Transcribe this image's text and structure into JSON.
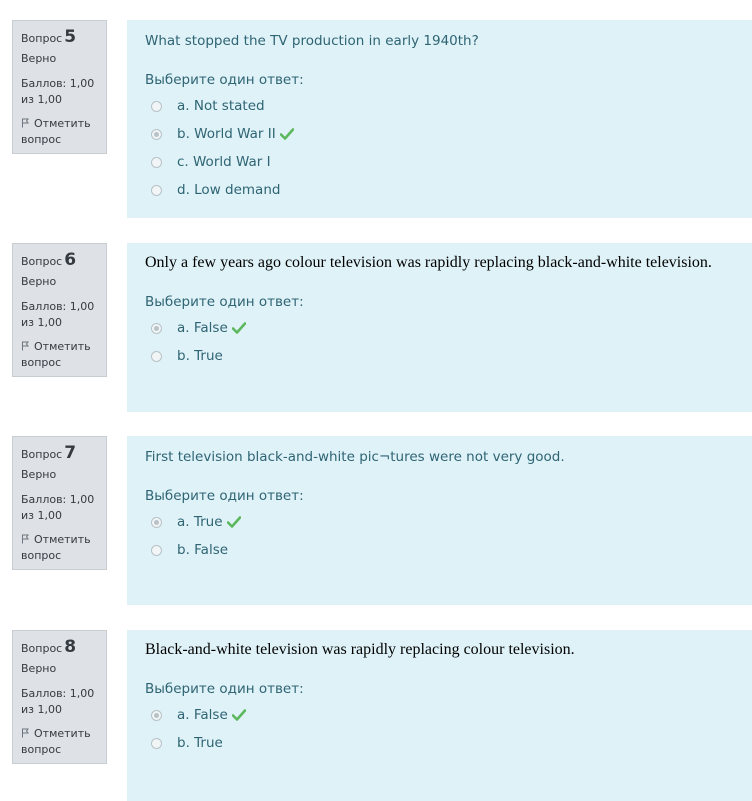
{
  "questions": [
    {
      "label": "Вопрос",
      "number": "5",
      "state": "Верно",
      "grade": "Баллов: 1,00 из 1,00",
      "flag": "Отметить вопрос",
      "text": "What stopped the TV production in early 1940th?",
      "prompt": "Выберите один ответ:",
      "options": [
        "a. Not stated",
        "b. World War II",
        "c. World War I",
        "d. Low demand"
      ],
      "selected_index": 1
    },
    {
      "label": "Вопрос",
      "number": "6",
      "state": "Верно",
      "grade": "Баллов: 1,00 из 1,00",
      "flag": "Отметить вопрос",
      "text": "Only a few years ago colour television was rapidly replacing black-and-white television.",
      "prompt": "Выберите один ответ:",
      "options": [
        "a. False",
        "b. True"
      ],
      "selected_index": 0
    },
    {
      "label": "Вопрос",
      "number": "7",
      "state": "Верно",
      "grade": "Баллов: 1,00 из 1,00",
      "flag": "Отметить вопрос",
      "text": "First television black-and-white pic¬tures were not very good.",
      "prompt": "Выберите один ответ:",
      "options": [
        "a. True",
        "b. False"
      ],
      "selected_index": 0
    },
    {
      "label": "Вопрос",
      "number": "8",
      "state": "Верно",
      "grade": "Баллов: 1,00 из 1,00",
      "flag": "Отметить вопрос",
      "text": "Black-and-white television was rapidly replacing colour television.",
      "prompt": "Выберите один ответ:",
      "options": [
        "a. False",
        "b. True"
      ],
      "selected_index": 0
    }
  ],
  "colors": {
    "info_bg": "#dee2e6",
    "content_bg": "#def2f8",
    "text": "#2f6473",
    "correct_check": "#5cb85c"
  },
  "icons": {
    "flag": "flag-icon",
    "correct": "check-icon"
  }
}
